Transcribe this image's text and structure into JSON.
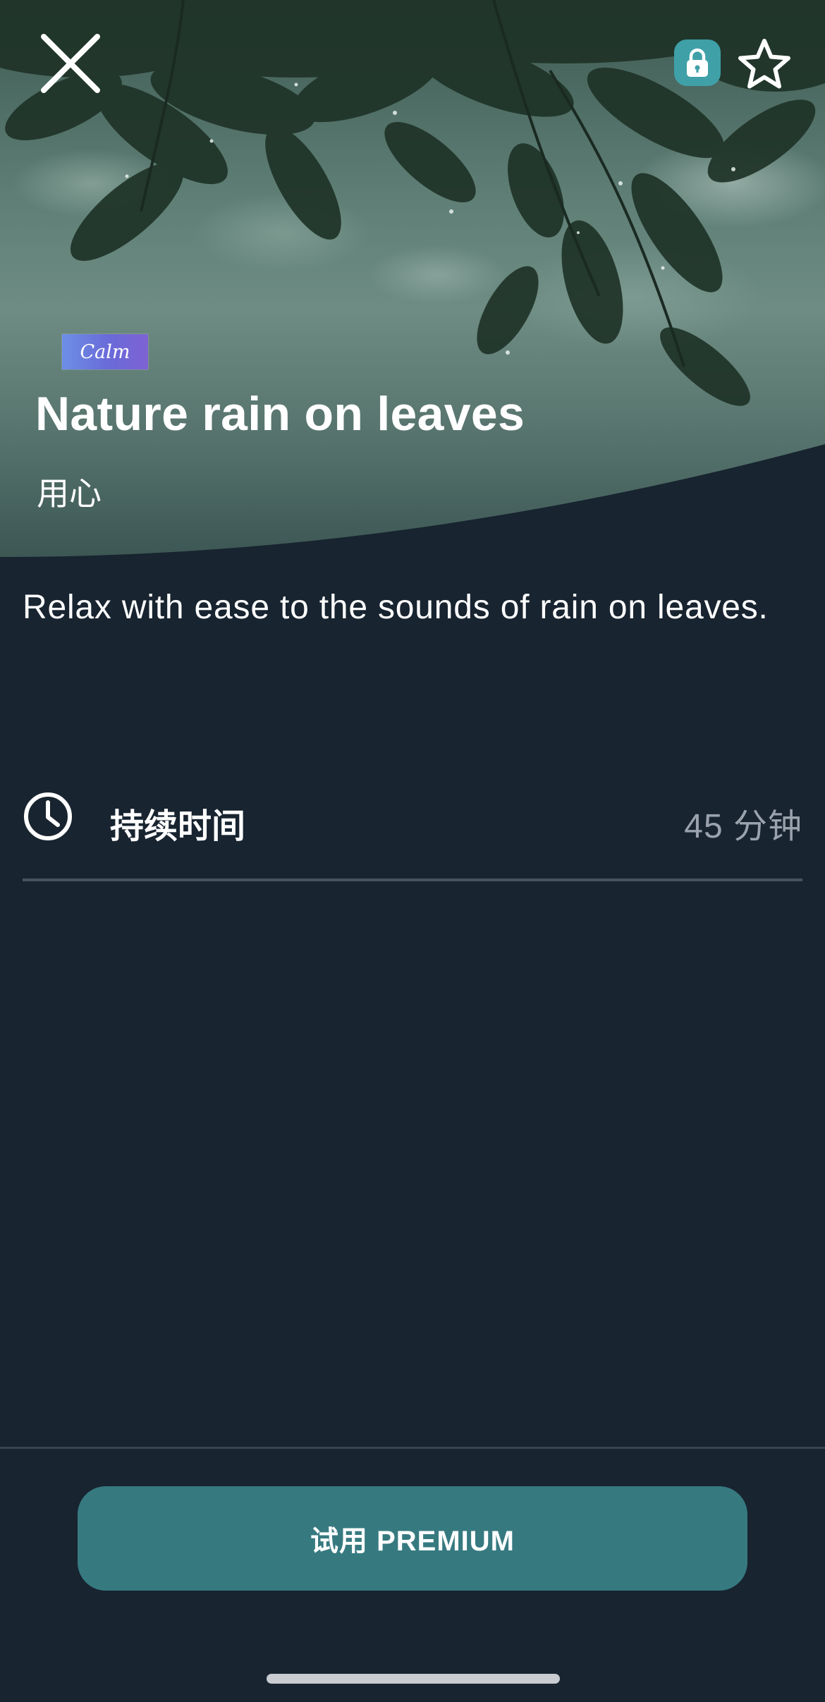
{
  "header": {
    "brand_logo_text": "Calm",
    "title": "Nature rain on leaves",
    "subtitle": "用心"
  },
  "icons": {
    "close": "close-icon",
    "lock": "lock-icon",
    "favorite": "star-icon",
    "duration": "clock-icon"
  },
  "body": {
    "description": "Relax with ease to the sounds of rain on leaves.",
    "duration_label": "持续时间",
    "duration_value": "45 分钟"
  },
  "footer": {
    "cta_label": "试用 PREMIUM"
  },
  "colors": {
    "background": "#182430",
    "cta": "#367a80",
    "lock_badge": "#3fa0a8",
    "muted_text": "#9aa3ad"
  }
}
